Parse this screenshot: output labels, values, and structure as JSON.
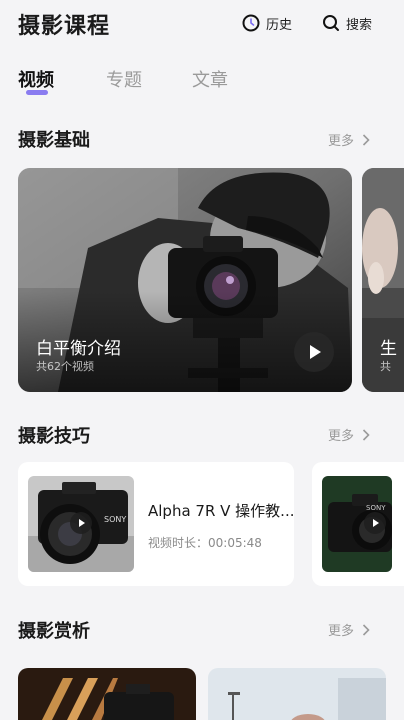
{
  "header": {
    "title": "摄影课程",
    "history_label": "历史",
    "search_label": "搜索"
  },
  "tabs": [
    {
      "label": "视频",
      "active": true
    },
    {
      "label": "专题",
      "active": false
    },
    {
      "label": "文章",
      "active": false
    }
  ],
  "accent_color": "#8a7cf0",
  "sections": {
    "basics": {
      "title": "摄影基础",
      "more_label": "更多",
      "cards": [
        {
          "title": "白平衡介绍",
          "subtitle": "共62个视频"
        },
        {
          "title": "生",
          "subtitle": "共"
        }
      ]
    },
    "skills": {
      "title": "摄影技巧",
      "more_label": "更多",
      "cards": [
        {
          "title": "Alpha 7R V 操作教...",
          "duration": "视频时长：00:05:48"
        }
      ]
    },
    "appreciation": {
      "title": "摄影赏析",
      "more_label": "更多"
    }
  }
}
